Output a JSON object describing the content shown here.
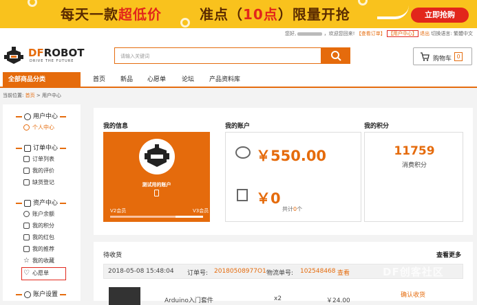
{
  "banner": {
    "slogan_pre": "每天一款",
    "slogan_hl": "超低价",
    "slogan2_pre": "准点（",
    "slogan2_hl": "10点",
    "slogan2_post": "）限量开抢",
    "cta": "立即抢购"
  },
  "toplinks": {
    "greeting": "您好,",
    "welcome": "，欢迎您回来!",
    "orders": "【查看订单】",
    "user_center": "【用户中心】",
    "logout": "退出",
    "lang_label": "切换语言:",
    "lang_value": "繁體中文"
  },
  "logo": {
    "name_pre": "DF",
    "name_post": "ROBOT",
    "tagline": "DRIVE THE FUTURE"
  },
  "search": {
    "placeholder": "请输入关键词"
  },
  "cart": {
    "label": "购物车",
    "count": "0"
  },
  "nav": {
    "all_categories": "全部商品分类",
    "items": [
      "首页",
      "新品",
      "心愿单",
      "论坛",
      "产品资料库"
    ]
  },
  "breadcrumb": {
    "prefix": "当前位置:",
    "home": "首页",
    "sep": ">",
    "current": "用户中心"
  },
  "sidebar": {
    "sections": [
      {
        "title": "用户中心",
        "items": [
          "个人中心"
        ]
      },
      {
        "title": "订单中心",
        "items": [
          "订单列表",
          "我的评价",
          "缺货登记"
        ]
      },
      {
        "title": "资产中心",
        "items": [
          "账户余额",
          "我的积分",
          "我的红包",
          "我的推荐",
          "我的收藏",
          "心愿单"
        ]
      },
      {
        "title": "账户设置",
        "items": []
      }
    ],
    "active_item": "个人中心",
    "highlighted_item": "心愿单"
  },
  "info": {
    "title": "我的信息",
    "username": "测试用的账户",
    "level_from": "V2会员",
    "level_to": "V3会员",
    "level_progress": 0.7
  },
  "account": {
    "title": "我的账户",
    "balance": "￥550.00",
    "redpacket": "￥0",
    "total_prefix": "共计",
    "total_count": "0",
    "total_suffix": "个"
  },
  "points": {
    "title": "我的积分",
    "value": "11759",
    "label": "消费积分"
  },
  "pending": {
    "title": "待收货",
    "more": "查看更多",
    "order": {
      "datetime": "2018-05-08 15:48:04",
      "order_label": "订单号:",
      "order_no": "20180508977O1",
      "logistics_label": "物流单号:",
      "logistics_no": "102548468",
      "view": "查看"
    },
    "product_name": "Arduino入门套件",
    "quantity": "x2",
    "price": "￥24.00",
    "confirm": "确认收货"
  },
  "watermark": "DF创客社区"
}
